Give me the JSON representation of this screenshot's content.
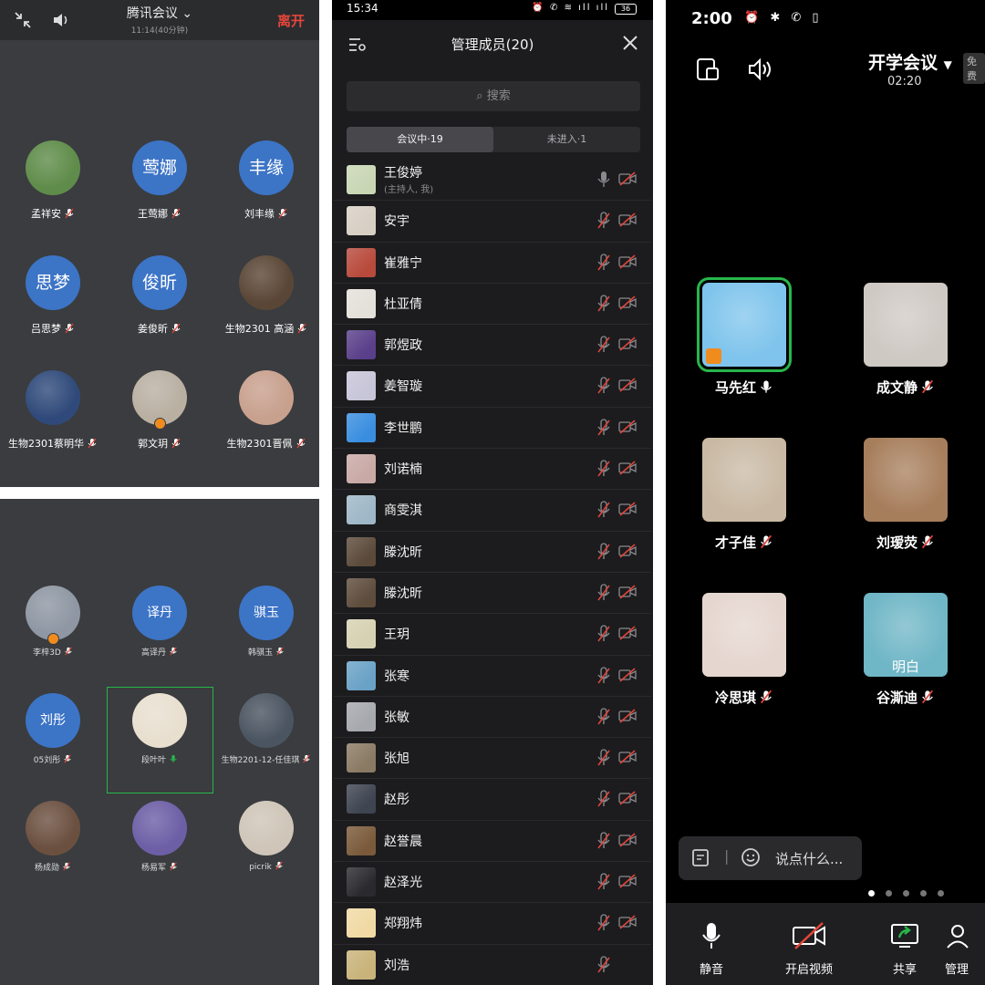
{
  "colors": {
    "panel_bg": "#3a3c3f",
    "header_bg": "#2b2c2e",
    "avatar_blue": "#3c74c6",
    "leave_red": "#e5453a",
    "active_green": "#27b64a",
    "host_orange": "#f08c1e",
    "sheet_bg": "#1c1c1e"
  },
  "panel1": {
    "title": "腾讯会议",
    "subtitle": "11:14(40分钟)",
    "leave_label": "离开",
    "participants": [
      {
        "name": "孟祥安",
        "initials": "",
        "photo": "#5f8c4a",
        "host": false
      },
      {
        "name": "王莺娜",
        "initials": "莺娜",
        "photo": "",
        "host": false
      },
      {
        "name": "刘丰缘",
        "initials": "丰缘",
        "photo": "",
        "host": false
      },
      {
        "name": "吕思梦",
        "initials": "思梦",
        "photo": "",
        "host": false
      },
      {
        "name": "姜俊昕",
        "initials": "俊昕",
        "photo": "",
        "host": false
      },
      {
        "name": "生物2301 高涵",
        "initials": "",
        "photo": "#5a4636",
        "host": false
      },
      {
        "name": "生物2301蔡明华",
        "initials": "",
        "photo": "#2f4a7a",
        "host": false
      },
      {
        "name": "郭文玥",
        "initials": "",
        "photo": "#b9b0a2",
        "host": true
      },
      {
        "name": "生物2301晋佩",
        "initials": "",
        "photo": "#c8a08e",
        "host": false
      }
    ]
  },
  "panel2": {
    "participants": [
      {
        "name": "李梓3D",
        "initials": "",
        "photo": "#8e97a3",
        "host": true
      },
      {
        "name": "高译丹",
        "initials": "译丹",
        "photo": "",
        "host": false
      },
      {
        "name": "韩骐玉",
        "initials": "骐玉",
        "photo": "",
        "host": false
      },
      {
        "name": "05刘彤",
        "initials": "刘彤",
        "photo": "",
        "host": false
      },
      {
        "name": "段叶叶",
        "initials": "",
        "photo": "#e8dfcf",
        "host": false,
        "speaking": true
      },
      {
        "name": "生物2201-12-任佳琪",
        "initials": "",
        "photo": "#4b5561",
        "host": false
      },
      {
        "name": "杨成勋",
        "initials": "",
        "photo": "#6b5040",
        "host": false
      },
      {
        "name": "杨易军",
        "initials": "",
        "photo": "#6d5fa6",
        "host": false
      },
      {
        "name": "picrik",
        "initials": "",
        "photo": "#cfc5b8",
        "host": false
      }
    ]
  },
  "panel3": {
    "status_time": "15:34",
    "battery": "36",
    "title": "管理成员(20)",
    "search_placeholder": "搜索",
    "tab_in_meeting": "会议中·19",
    "tab_not_joined": "未进入·1",
    "members": [
      {
        "name": "王俊婷",
        "note": "(主持人, 我)",
        "photo": "#c9d6b4",
        "mic_on": true
      },
      {
        "name": "安宇",
        "note": "",
        "photo": "#d7cfc4",
        "mic_on": false
      },
      {
        "name": "崔雅宁",
        "note": "",
        "photo": "#b84a3c",
        "mic_on": false
      },
      {
        "name": "杜亚倩",
        "note": "",
        "photo": "#e4e0da",
        "mic_on": false
      },
      {
        "name": "郭煜政",
        "note": "",
        "photo": "#5a3f8a",
        "mic_on": false
      },
      {
        "name": "姜智璇",
        "note": "",
        "photo": "#c7c5d8",
        "mic_on": false
      },
      {
        "name": "李世鹏",
        "note": "",
        "photo": "#3a8ee0",
        "mic_on": false
      },
      {
        "name": "刘诺楠",
        "note": "",
        "photo": "#c9a9a6",
        "mic_on": false
      },
      {
        "name": "商雯淇",
        "note": "",
        "photo": "#9fb7c7",
        "mic_on": false
      },
      {
        "name": "滕沈昕",
        "note": "",
        "photo": "#5b4a3a",
        "mic_on": false
      },
      {
        "name": "滕沈昕",
        "note": "",
        "photo": "#5e4c3c",
        "mic_on": false
      },
      {
        "name": "王玥",
        "note": "",
        "photo": "#d6d1b2",
        "mic_on": false
      },
      {
        "name": "张寒",
        "note": "",
        "photo": "#6aa2c6",
        "mic_on": false
      },
      {
        "name": "张敏",
        "note": "",
        "photo": "#a6a8ae",
        "mic_on": false
      },
      {
        "name": "张旭",
        "note": "",
        "photo": "#8a7a64",
        "mic_on": false
      },
      {
        "name": "赵彤",
        "note": "",
        "photo": "#3e4450",
        "mic_on": false
      },
      {
        "name": "赵誉晨",
        "note": "",
        "photo": "#7a5a3a",
        "mic_on": false
      },
      {
        "name": "赵泽光",
        "note": "",
        "photo": "#2a2a2e",
        "mic_on": false
      },
      {
        "name": "郑翔炜",
        "note": "",
        "photo": "#f0d9a4",
        "mic_on": false
      },
      {
        "name": "刘浩",
        "note": "",
        "photo": "#c9b37a",
        "mic_on": false
      }
    ]
  },
  "panel4": {
    "status_time": "2:00",
    "title": "开学会议",
    "timer": "02:20",
    "free_badge": "免费",
    "chat_placeholder": "说点什么...",
    "page_dots": 5,
    "video_tiles": [
      {
        "name": "马先红",
        "photo": "#7fc4ec",
        "mic_on": true,
        "active": true
      },
      {
        "name": "成文静",
        "photo": "#cfc9c4",
        "mic_on": false,
        "active": false
      },
      {
        "name": "才子佳",
        "photo": "#c9b9a4",
        "mic_on": false,
        "active": false
      },
      {
        "name": "刘瑷荧",
        "photo": "#a77e5c",
        "mic_on": false,
        "active": false
      },
      {
        "name": "冷思琪",
        "photo": "#e5d6cf",
        "mic_on": false,
        "active": false
      },
      {
        "name": "谷澌迪",
        "photo": "#6fb6c6",
        "mic_on": false,
        "active": false,
        "overlay": "明白"
      }
    ],
    "toolbar": {
      "mute": "静音",
      "video": "开启视频",
      "share": "共享",
      "manage": "管理"
    }
  }
}
